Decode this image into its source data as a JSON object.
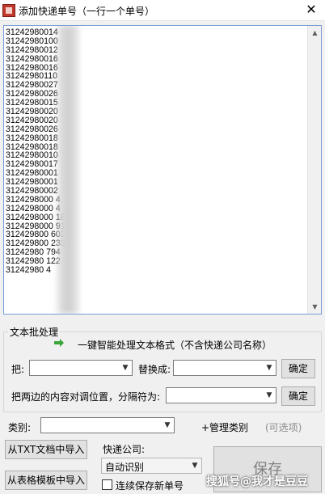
{
  "window": {
    "title": "添加快递单号（一行一个单号）",
    "close_glyph": "✕"
  },
  "numbers": {
    "lines": [
      "31242980014",
      "31242980100",
      "31242980012",
      "31242980016",
      "31242980016",
      "31242980110",
      "31242980027",
      "31242980026",
      "31242980015",
      "31242980020",
      "31242980020",
      "31242980026",
      "31242980018",
      "31242980018",
      "31242980010",
      "31242980017",
      "31242980001",
      "31242980001",
      "31242980002",
      "3124298000   4",
      "3124298000   4",
      "3124298000   18",
      "3124298000   91",
      "312429800    602",
      "312429800    233",
      "31242980     794",
      "31242980     122",
      "31242980     4"
    ]
  },
  "text_processing": {
    "group_title": "文本批处理",
    "smart_label": "一键智能处理文本格式（不含快递公司名称）",
    "replace_from_label": "把:",
    "replace_to_label": "替换成:",
    "replace_button": "确定",
    "swap_label": "把两边的内容对调位置，分隔符为:",
    "swap_button": "确定"
  },
  "category": {
    "label": "类别:",
    "manage_link": "+管理类别",
    "optional_note": "(可选项)"
  },
  "import": {
    "txt_button": "从TXT文档中导入",
    "template_button": "从表格模板中导入"
  },
  "courier": {
    "label": "快递公司:",
    "selected": "自动识别",
    "continuous_save_label": "连续保存新单号"
  },
  "save_button": "保存",
  "watermark": "搜狐号@我才是豆豆",
  "colors": {
    "accent_arrow": "#3aa53a",
    "textarea_border": "#7a9cd3"
  }
}
